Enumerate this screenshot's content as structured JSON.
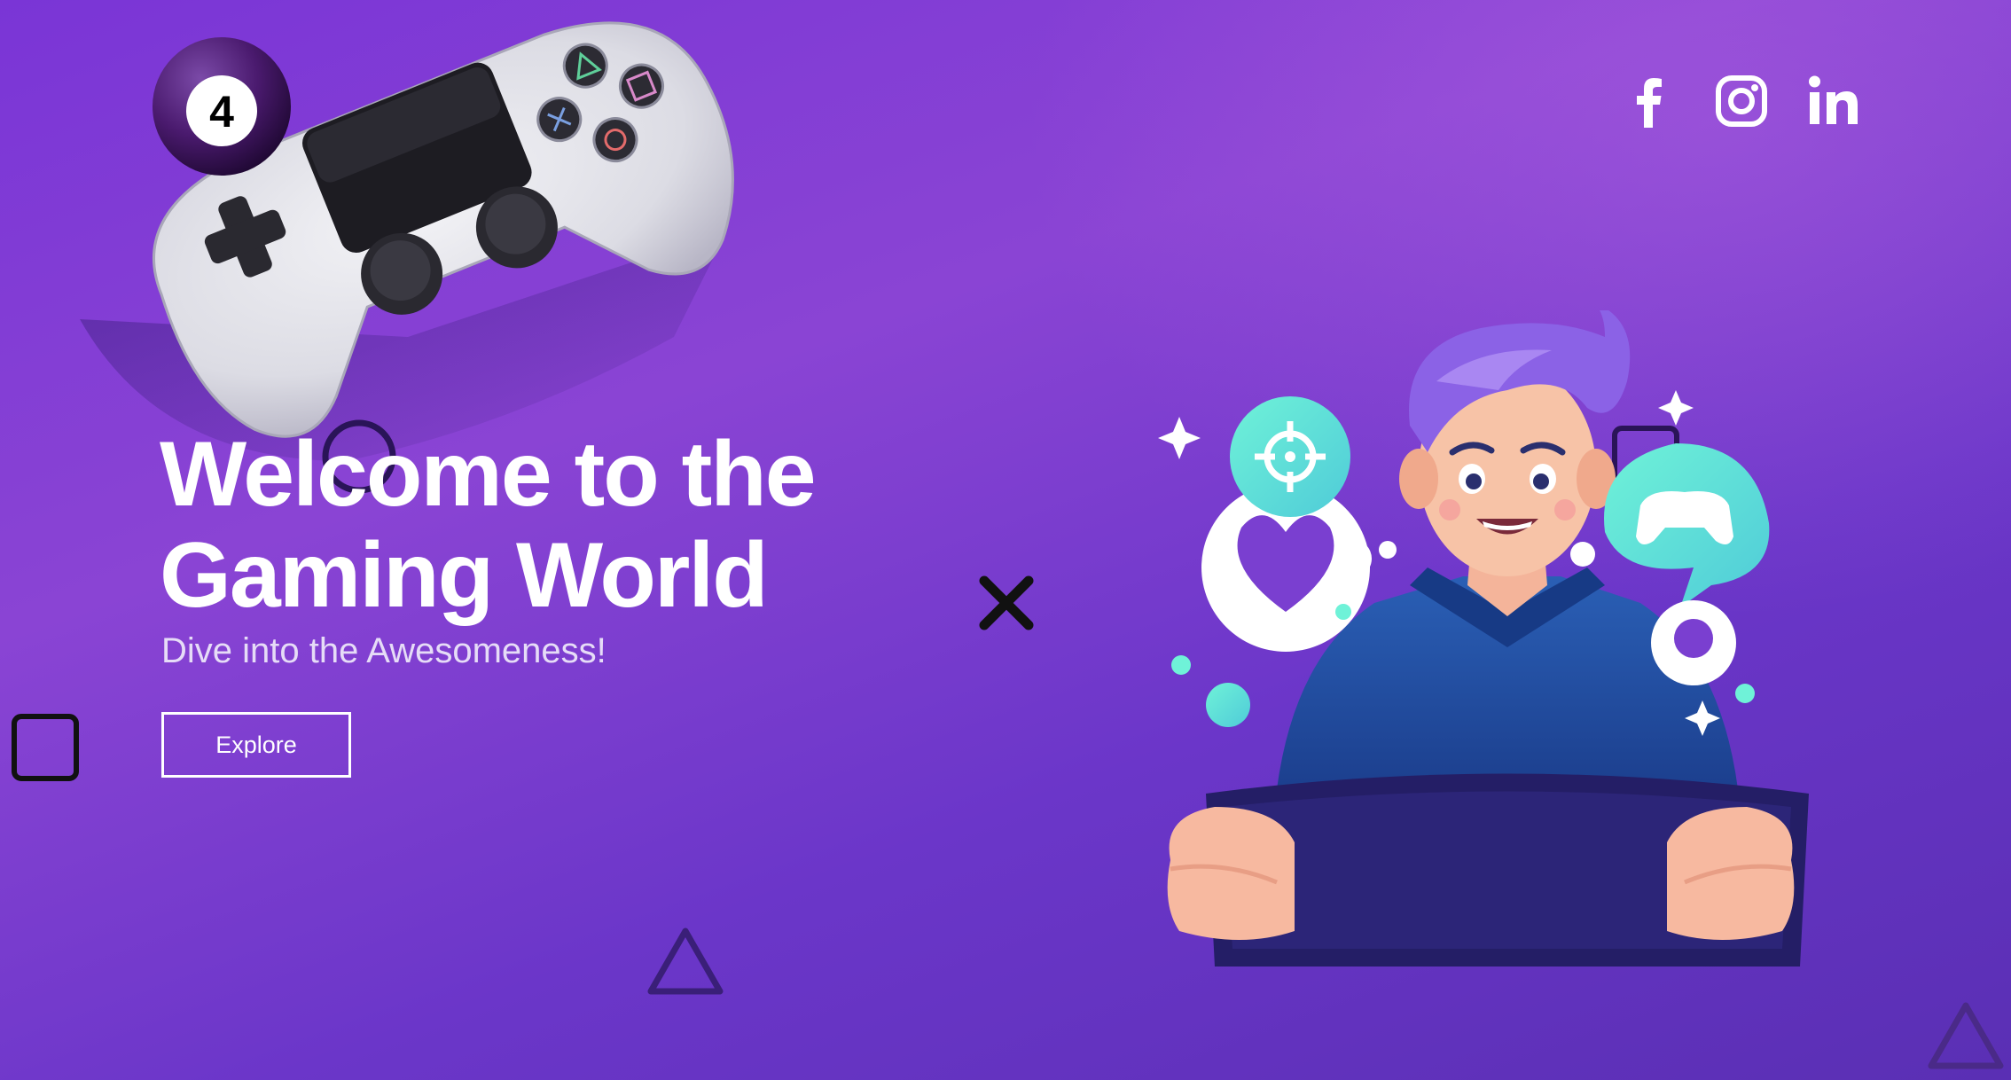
{
  "logo": {
    "number": "4"
  },
  "social": {
    "icons": [
      "facebook-icon",
      "instagram-icon",
      "linkedin-icon"
    ]
  },
  "hero": {
    "title_line1": "Welcome to the",
    "title_line2": "Gaming World",
    "subtitle": "Dive into the Awesomeness!",
    "cta_label": "Explore"
  },
  "colors": {
    "background_start": "#7a35d6",
    "background_end": "#5a2fb4",
    "accent_teal": "#5fe3d0",
    "text": "#ffffff"
  }
}
